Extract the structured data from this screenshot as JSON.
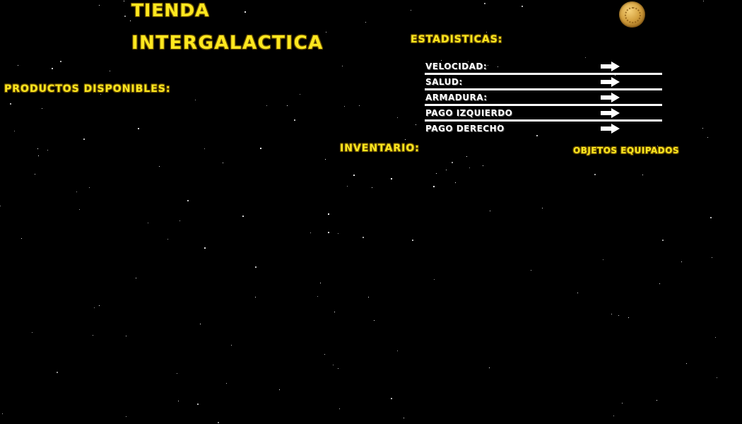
{
  "header": {
    "title_line1": "TIENDA",
    "title_line2": "INTERGALACTICA"
  },
  "sections": {
    "products_label": "PRODUCTOS DISPONIBLES:",
    "stats_label": "ESTADISTICAS:",
    "inventory_label": "INVENTARIO:",
    "equipped_label": "OBJETOS EQUIPADOS"
  },
  "stats": [
    {
      "label": "VELOCIDAD:",
      "action_icon": "arrow-right-icon"
    },
    {
      "label": "SALUD:",
      "action_icon": "arrow-right-icon"
    },
    {
      "label": "ARMADURA:",
      "action_icon": "arrow-right-icon"
    },
    {
      "label": "PAGO IZQUIERDO",
      "action_icon": "arrow-right-icon"
    },
    {
      "label": "PAGO DERECHO",
      "action_icon": "arrow-right-icon"
    }
  ],
  "currency_icon": "coin-icon",
  "colors": {
    "background": "#000000",
    "title_yellow": "#ffe81f",
    "stat_text": "#ffffff",
    "divider": "#ffffff"
  }
}
